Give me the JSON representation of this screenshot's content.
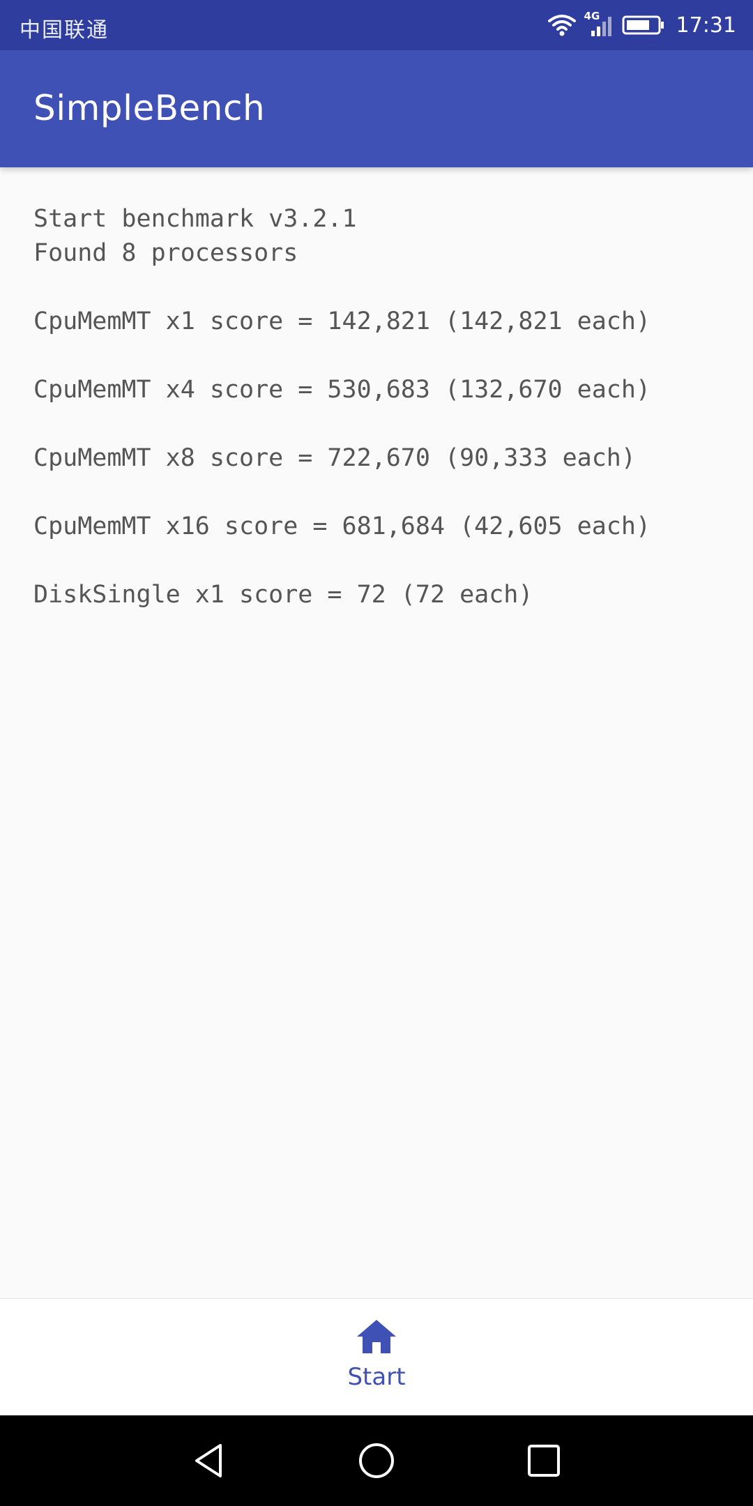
{
  "status_bar": {
    "carrier": "中国联通",
    "network": "4G",
    "time": "17:31",
    "icons": [
      "wifi-icon",
      "cellular-signal-icon",
      "battery-icon"
    ]
  },
  "app_bar": {
    "title": "SimpleBench"
  },
  "results": {
    "lines": [
      "Start benchmark v3.2.1",
      "Found 8 processors",
      "CpuMemMT x1 score = 142,821 (142,821 each)",
      "CpuMemMT x4 score = 530,683 (132,670 each)",
      "CpuMemMT x8 score = 722,670 (90,333 each)",
      "CpuMemMT x16 score = 681,684 (42,605 each)",
      "DiskSingle x1 score = 72 (72 each)"
    ]
  },
  "bottom_nav": {
    "items": [
      {
        "label": "Start",
        "icon": "home-icon",
        "active": true
      }
    ]
  },
  "system_nav": {
    "icons": [
      "back-icon",
      "home-circle-icon",
      "recents-icon"
    ]
  },
  "colors": {
    "status_bar": "#2f3e9e",
    "app_bar": "#3f51b5",
    "accent": "#3f51b5",
    "text": "#555555",
    "background": "#fafafa"
  }
}
